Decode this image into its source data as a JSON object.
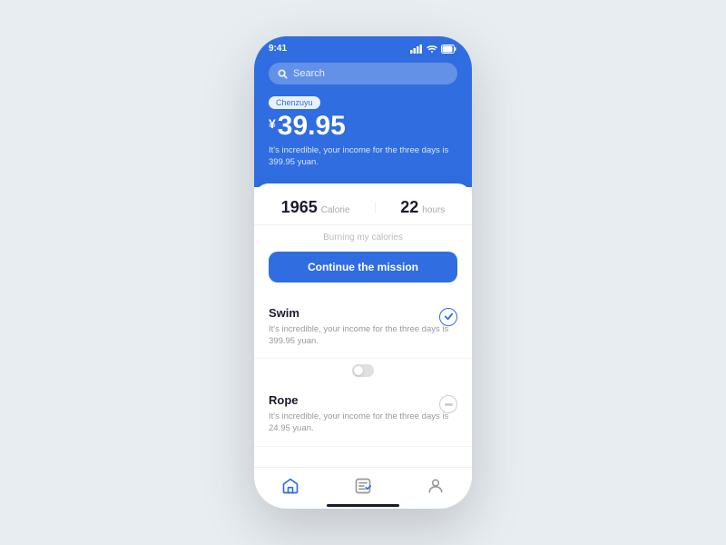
{
  "statusBar": {
    "time": "9:41"
  },
  "header": {
    "searchPlaceholder": "Search",
    "tagLabel": "Chenzuyu",
    "currencySymbol": "¥",
    "priceValue": "39.95",
    "priceDesc": "It's incredible, your income for the three days is 399.95 yuan."
  },
  "stats": {
    "calorieValue": "1965",
    "calorieLabel": "Calorie",
    "hoursValue": "22",
    "hoursLabel": "hours",
    "burningText": "Burning my calories",
    "continueLabel": "Continue the mission"
  },
  "activities": [
    {
      "title": "Swim",
      "desc": "It's incredible, your income for the three days is 399.95 yuan.",
      "checked": true
    },
    {
      "title": "Rope",
      "desc": "It's incredible, your income for the three days is 24.95 yuan.",
      "checked": false
    }
  ],
  "bottomNav": {
    "items": [
      "home",
      "activity",
      "profile"
    ]
  }
}
